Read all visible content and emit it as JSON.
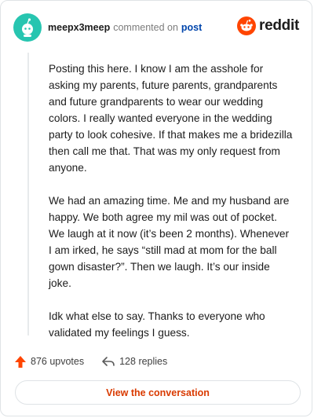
{
  "header": {
    "username": "meepx3meep",
    "action": "commented on",
    "link_text": "post",
    "brand": "reddit"
  },
  "comment": {
    "paragraphs": [
      "Posting this here. I know I am the asshole for asking my parents, future parents, grandparents and future grandparents to wear our wedding colors. I really wanted everyone in the wedding party to look cohesive. If that makes me a bridezilla then call me that. That was my only request from anyone.",
      "We had an amazing time. Me and my husband are happy. We both agree my mil was out of pocket. We laugh at it now (it’s been 2 months). Whenever I am irked, he says “still mad at mom for the ball gown disaster?”. Then we laugh. It’s our inside joke.",
      "Idk what else to say. Thanks to everyone who validated my feelings I guess."
    ]
  },
  "stats": {
    "upvotes": "876 upvotes",
    "replies": "128 replies"
  },
  "cta": {
    "label": "View the conversation"
  },
  "colors": {
    "avatar": "#27c5b0",
    "brand_orange": "#ff4500",
    "link_blue": "#0045ac",
    "cta_text": "#d93a00"
  },
  "icons": [
    "avatar-snoo-icon",
    "reddit-logo-icon",
    "upvote-arrow-icon",
    "reply-arrow-icon"
  ]
}
